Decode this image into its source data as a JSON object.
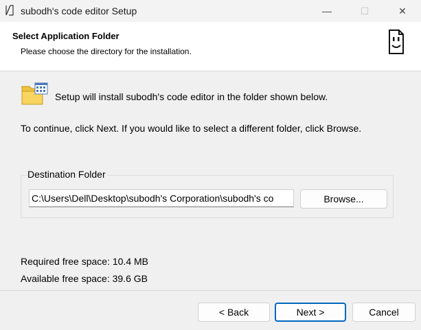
{
  "window": {
    "title": "subodh's code editor Setup",
    "controls": {
      "minimize": "—",
      "maximize": "☐",
      "close": "✕"
    }
  },
  "header": {
    "title": "Select Application Folder",
    "subtitle": "Please choose the directory for the installation.",
    "logo_icon": "smiley-document-icon"
  },
  "body": {
    "intro": "Setup will install subodh's code editor in the folder shown below.",
    "continue_text": "To continue, click Next. If you would like to select a different folder, click Browse.",
    "folder_icon": "folder-icon"
  },
  "destination": {
    "legend": "Destination Folder",
    "path": "C:\\Users\\Dell\\Desktop\\subodh's Corporation\\subodh's co",
    "browse_label": "Browse..."
  },
  "space": {
    "required": "Required free space: 10.4 MB",
    "available": "Available free space: 39.6 GB"
  },
  "footer": {
    "back_label": "< Back",
    "next_label": "Next >",
    "cancel_label": "Cancel"
  },
  "colors": {
    "accent": "#0067c0",
    "background": "#f0f0f0",
    "header_background": "#ffffff"
  }
}
